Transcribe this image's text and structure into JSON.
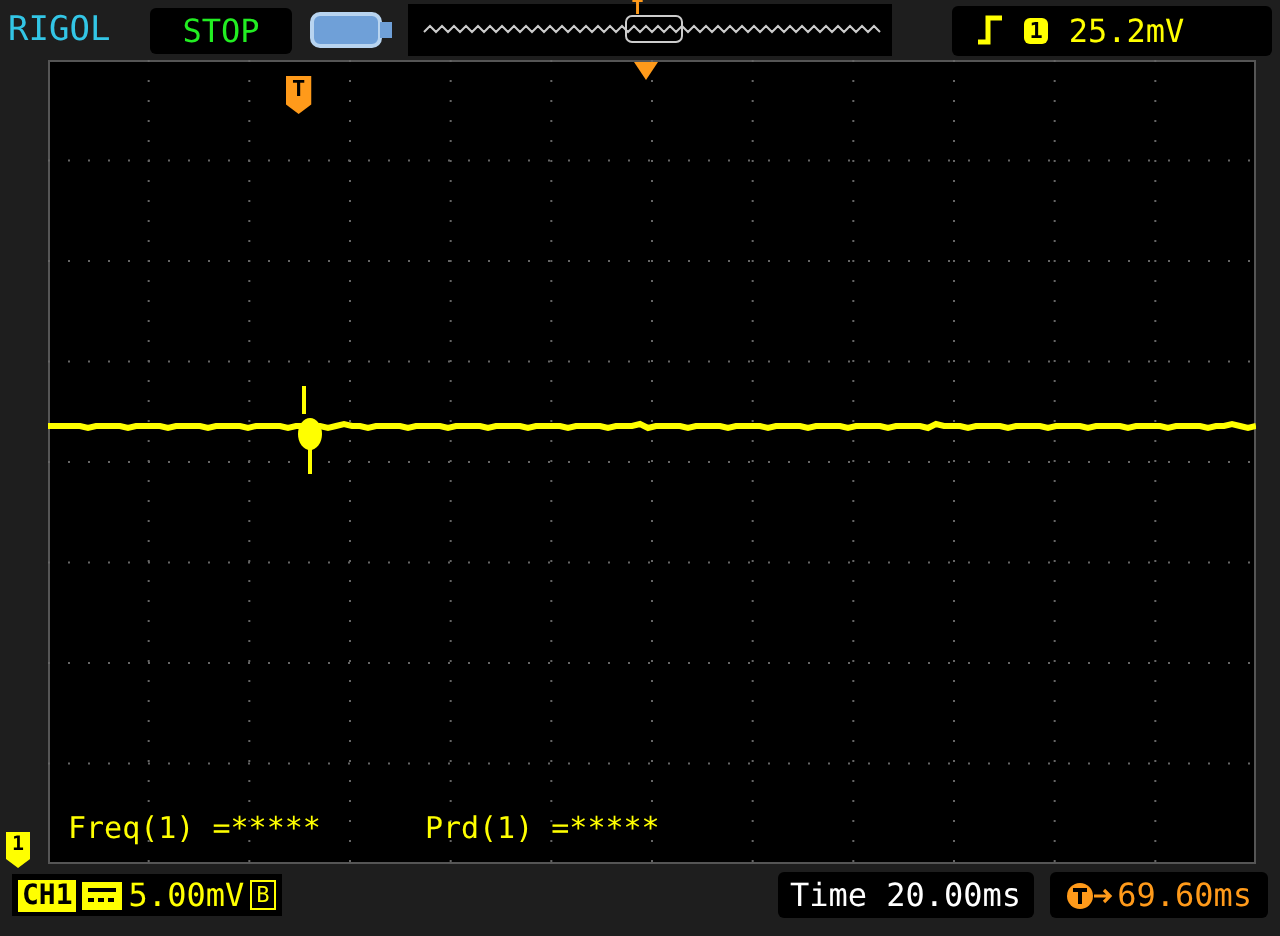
{
  "brand": "RIGOL",
  "run_state": "STOP",
  "trigger": {
    "channel": "1",
    "level": "25.2mV"
  },
  "trigger_markers": {
    "position_label": "T",
    "memory_label": "T"
  },
  "channel_marker": "1",
  "measurements": [
    {
      "text": "Freq(1) =*****"
    },
    {
      "text": "Prd(1) =*****"
    }
  ],
  "channel": {
    "name": "CH1",
    "scale": "5.00mV",
    "bandwidth_limit": "B"
  },
  "timebase": "Time 20.00ms",
  "trigger_offset": "69.60ms"
}
